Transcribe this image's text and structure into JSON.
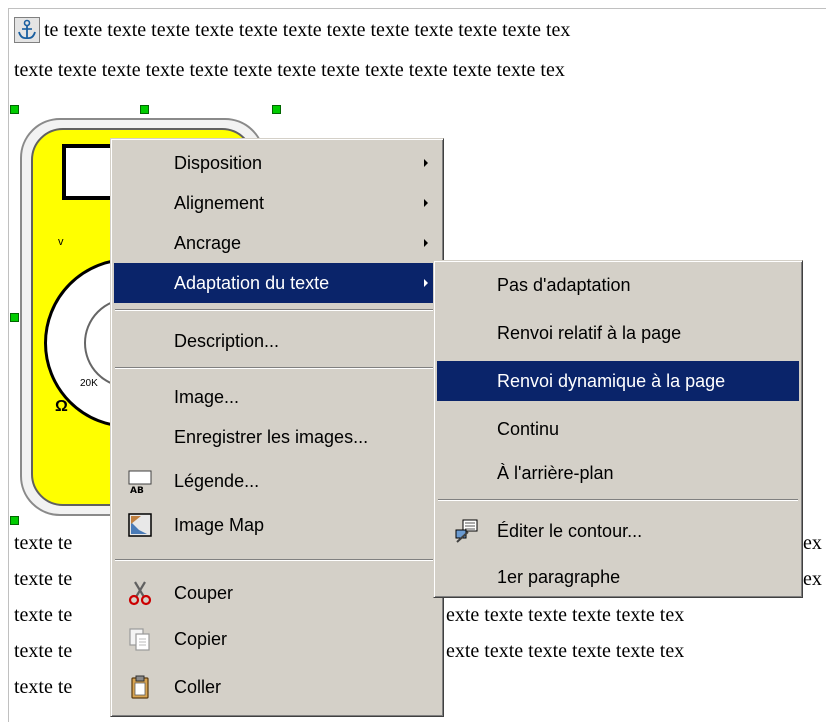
{
  "document": {
    "line_1": "te texte texte texte texte texte texte texte texte texte texte texte tex",
    "line_2": "texte texte texte texte texte texte texte texte texte texte texte texte tex",
    "lower_left": [
      "texte te",
      "texte te",
      "texte te",
      "texte te",
      "texte te"
    ],
    "lower_right": [
      "ex",
      "ex",
      "exte texte texte texte texte tex",
      "exte texte texte texte texte tex"
    ],
    "meter": {
      "v_label": "v",
      "range_label": "20K",
      "ohm_label": "Ω"
    }
  },
  "context_menu": {
    "items": [
      {
        "label": "Disposition",
        "submenu": true
      },
      {
        "label": "Alignement",
        "submenu": true
      },
      {
        "label": "Ancrage",
        "submenu": true
      },
      {
        "label": "Adaptation du texte",
        "submenu": true,
        "highlighted": true
      },
      {
        "label": "Description..."
      },
      {
        "label": "Image..."
      },
      {
        "label": "Enregistrer les images..."
      },
      {
        "label": "Légende...",
        "icon": "caption-icon"
      },
      {
        "label": "Image Map",
        "icon": "image-map-icon"
      },
      {
        "label": "Couper",
        "icon": "scissors-icon"
      },
      {
        "label": "Copier",
        "icon": "copy-icon"
      },
      {
        "label": "Coller",
        "icon": "paste-icon"
      }
    ]
  },
  "submenu": {
    "items": [
      {
        "label": "Pas d'adaptation"
      },
      {
        "label": "Renvoi relatif à la page"
      },
      {
        "label": "Renvoi dynamique à la page",
        "highlighted": true
      },
      {
        "label": "Continu"
      },
      {
        "label": "À l'arrière-plan"
      },
      {
        "label": "Éditer le contour...",
        "icon": "contour-edit-icon"
      },
      {
        "label": "1er paragraphe"
      }
    ]
  },
  "colors": {
    "menu_bg": "#d4d0c8",
    "highlight": "#0a246a",
    "selection_handle": "#00cc00",
    "meter_body": "#ffff00"
  }
}
